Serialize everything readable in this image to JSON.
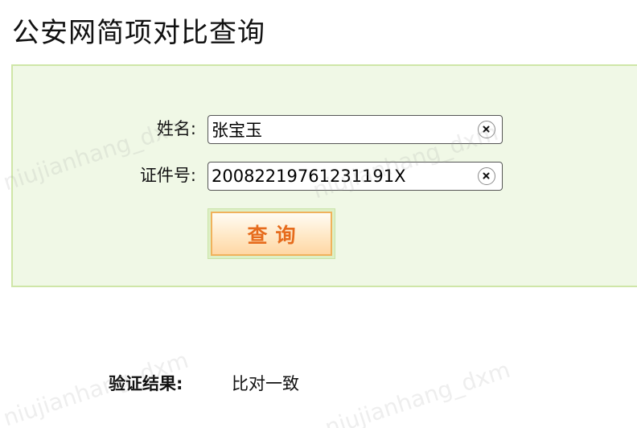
{
  "page": {
    "title": "公安网简项对比查询"
  },
  "form": {
    "name_label": "姓名:",
    "name_value": "张宝玉",
    "id_label": "证件号:",
    "id_value": "20082219761231191X",
    "clear_icon": "clear-circle-x-icon",
    "submit_label": "查询"
  },
  "result": {
    "label": "验证结果:",
    "value": "比对一致"
  },
  "watermark": {
    "text": "niujianhang_dxm"
  },
  "colors": {
    "panel_background": "#f0f8e6",
    "panel_border": "#cfe6a8",
    "button_text": "#e66b1c",
    "button_border": "#f0b25c"
  }
}
